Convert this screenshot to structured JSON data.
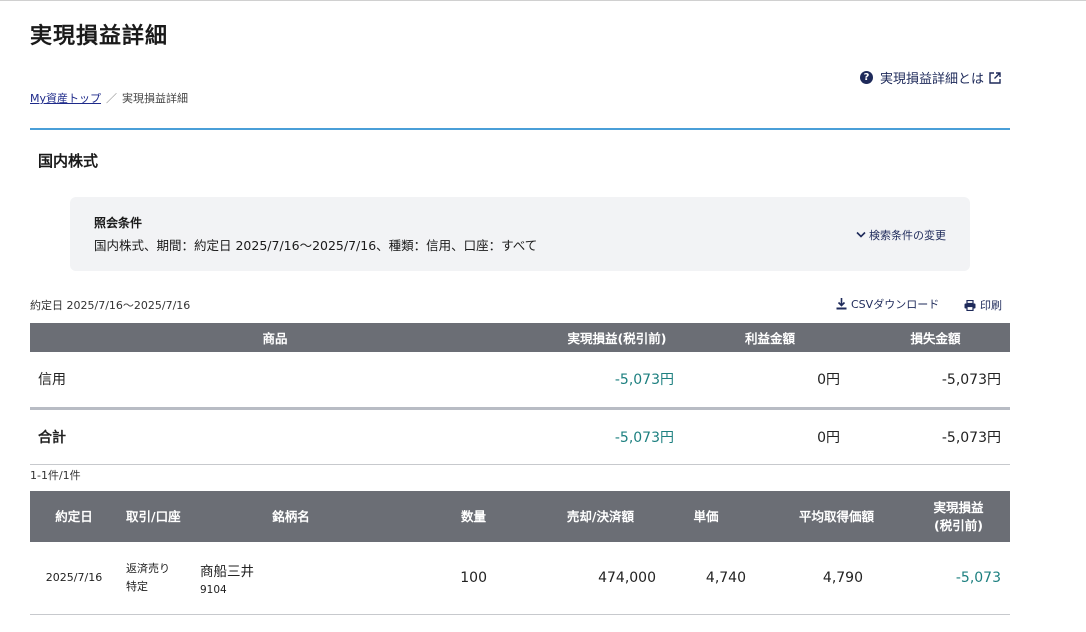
{
  "page": {
    "title": "実現損益詳細",
    "help_link": "実現損益詳細とは"
  },
  "breadcrumb": {
    "home": "My資産トップ",
    "separator": "／",
    "current": "実現損益詳細"
  },
  "section": {
    "title": "国内株式"
  },
  "conditions": {
    "title": "照会条件",
    "text": "国内株式、期間：約定日 2025/7/16〜2025/7/16、種類：信用、口座：すべて",
    "change_label": "検索条件の変更"
  },
  "toolbar": {
    "period": "約定日 2025/7/16〜2025/7/16",
    "csv_label": "CSVダウンロード",
    "print_label": "印刷"
  },
  "summary_table": {
    "headers": [
      "商品",
      "実現損益(税引前)",
      "利益金額",
      "損失金額"
    ],
    "rows": [
      {
        "product": "信用",
        "pl": "-5,073円",
        "profit": "0円",
        "loss": "-5,073円"
      },
      {
        "product": "合計",
        "pl": "-5,073円",
        "profit": "0円",
        "loss": "-5,073円"
      }
    ]
  },
  "count_text": "1-1件/1件",
  "detail_table": {
    "headers": {
      "date": "約定日",
      "trade": "取引/口座",
      "name": "銘柄名",
      "qty": "数量",
      "amount": "売却/決済額",
      "price": "単価",
      "avg": "平均取得価額",
      "pl_line1": "実現損益",
      "pl_line2": "(税引前)"
    },
    "rows": [
      {
        "date": "2025/7/16",
        "trade": "返済売り",
        "account": "特定",
        "name": "商船三井",
        "code": "9104",
        "qty": "100",
        "amount": "474,000",
        "price": "4,740",
        "avg": "4,790",
        "pl": "-5,073"
      }
    ]
  },
  "colors": {
    "header_bg": "#6b6e75",
    "accent_blue": "#4a9fd8",
    "loss_teal": "#1e8080",
    "link_navy": "#1e2a5a"
  }
}
